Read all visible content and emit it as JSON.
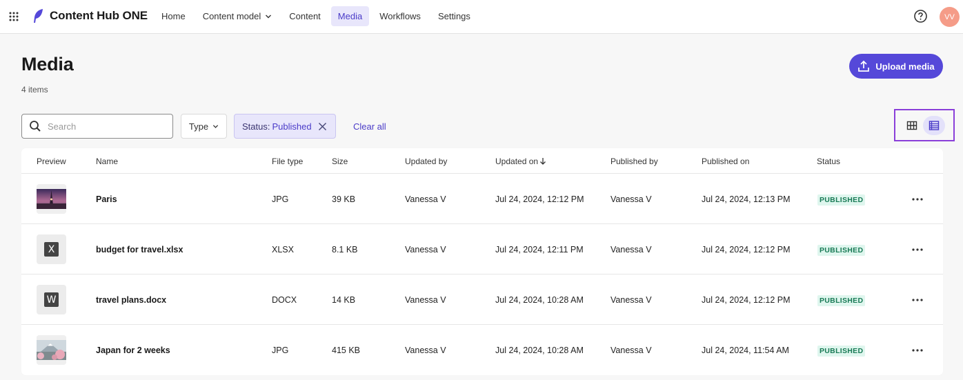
{
  "app": {
    "name": "Content Hub ONE"
  },
  "nav": {
    "items": [
      {
        "label": "Home"
      },
      {
        "label": "Content model"
      },
      {
        "label": "Content"
      },
      {
        "label": "Media"
      },
      {
        "label": "Workflows"
      },
      {
        "label": "Settings"
      }
    ],
    "active": "Media"
  },
  "user": {
    "initials": "VV"
  },
  "icons": {
    "apps": "apps-grid-icon",
    "help": "help-circle-icon",
    "upload": "upload-icon",
    "search": "search-icon",
    "chevron": "chevron-down-icon",
    "close": "close-icon",
    "grid_view": "grid-view-icon",
    "list_view": "list-view-icon",
    "more": "more-horizontal-icon",
    "sort": "arrow-down-icon"
  },
  "header": {
    "title": "Media",
    "count": "4 items",
    "upload_label": "Upload media"
  },
  "filters": {
    "search_placeholder": "Search",
    "type_label": "Type",
    "status_key": "Status:",
    "status_value": "Published",
    "clear_all": "Clear all"
  },
  "table": {
    "columns": {
      "preview": "Preview",
      "name": "Name",
      "file_type": "File type",
      "size": "Size",
      "updated_by": "Updated by",
      "updated_on": "Updated on",
      "published_by": "Published by",
      "published_on": "Published on",
      "status": "Status"
    },
    "rows": [
      {
        "name": "Paris",
        "file_type": "JPG",
        "size": "39 KB",
        "updated_by": "Vanessa V",
        "updated_on": "Jul 24, 2024, 12:12 PM",
        "published_by": "Vanessa V",
        "published_on": "Jul 24, 2024, 12:13 PM",
        "status": "PUBLISHED",
        "preview": "image-paris"
      },
      {
        "name": "budget for travel.xlsx",
        "file_type": "XLSX",
        "size": "8.1 KB",
        "updated_by": "Vanessa V",
        "updated_on": "Jul 24, 2024, 12:11 PM",
        "published_by": "Vanessa V",
        "published_on": "Jul 24, 2024, 12:12 PM",
        "status": "PUBLISHED",
        "preview": "X"
      },
      {
        "name": "travel plans.docx",
        "file_type": "DOCX",
        "size": "14 KB",
        "updated_by": "Vanessa V",
        "updated_on": "Jul 24, 2024, 10:28 AM",
        "published_by": "Vanessa V",
        "published_on": "Jul 24, 2024, 12:12 PM",
        "status": "PUBLISHED",
        "preview": "W"
      },
      {
        "name": "Japan for 2 weeks",
        "file_type": "JPG",
        "size": "415 KB",
        "updated_by": "Vanessa V",
        "updated_on": "Jul 24, 2024, 10:28 AM",
        "published_by": "Vanessa V",
        "published_on": "Jul 24, 2024, 11:54 AM",
        "status": "PUBLISHED",
        "preview": "image-japan"
      }
    ]
  },
  "colors": {
    "accent": "#5548d9",
    "accent_light": "#e8e6fb",
    "published_bg": "#dff6ee",
    "published_text": "#187a55",
    "avatar": "#f59c88",
    "focus_outline": "#8a3ed9"
  }
}
